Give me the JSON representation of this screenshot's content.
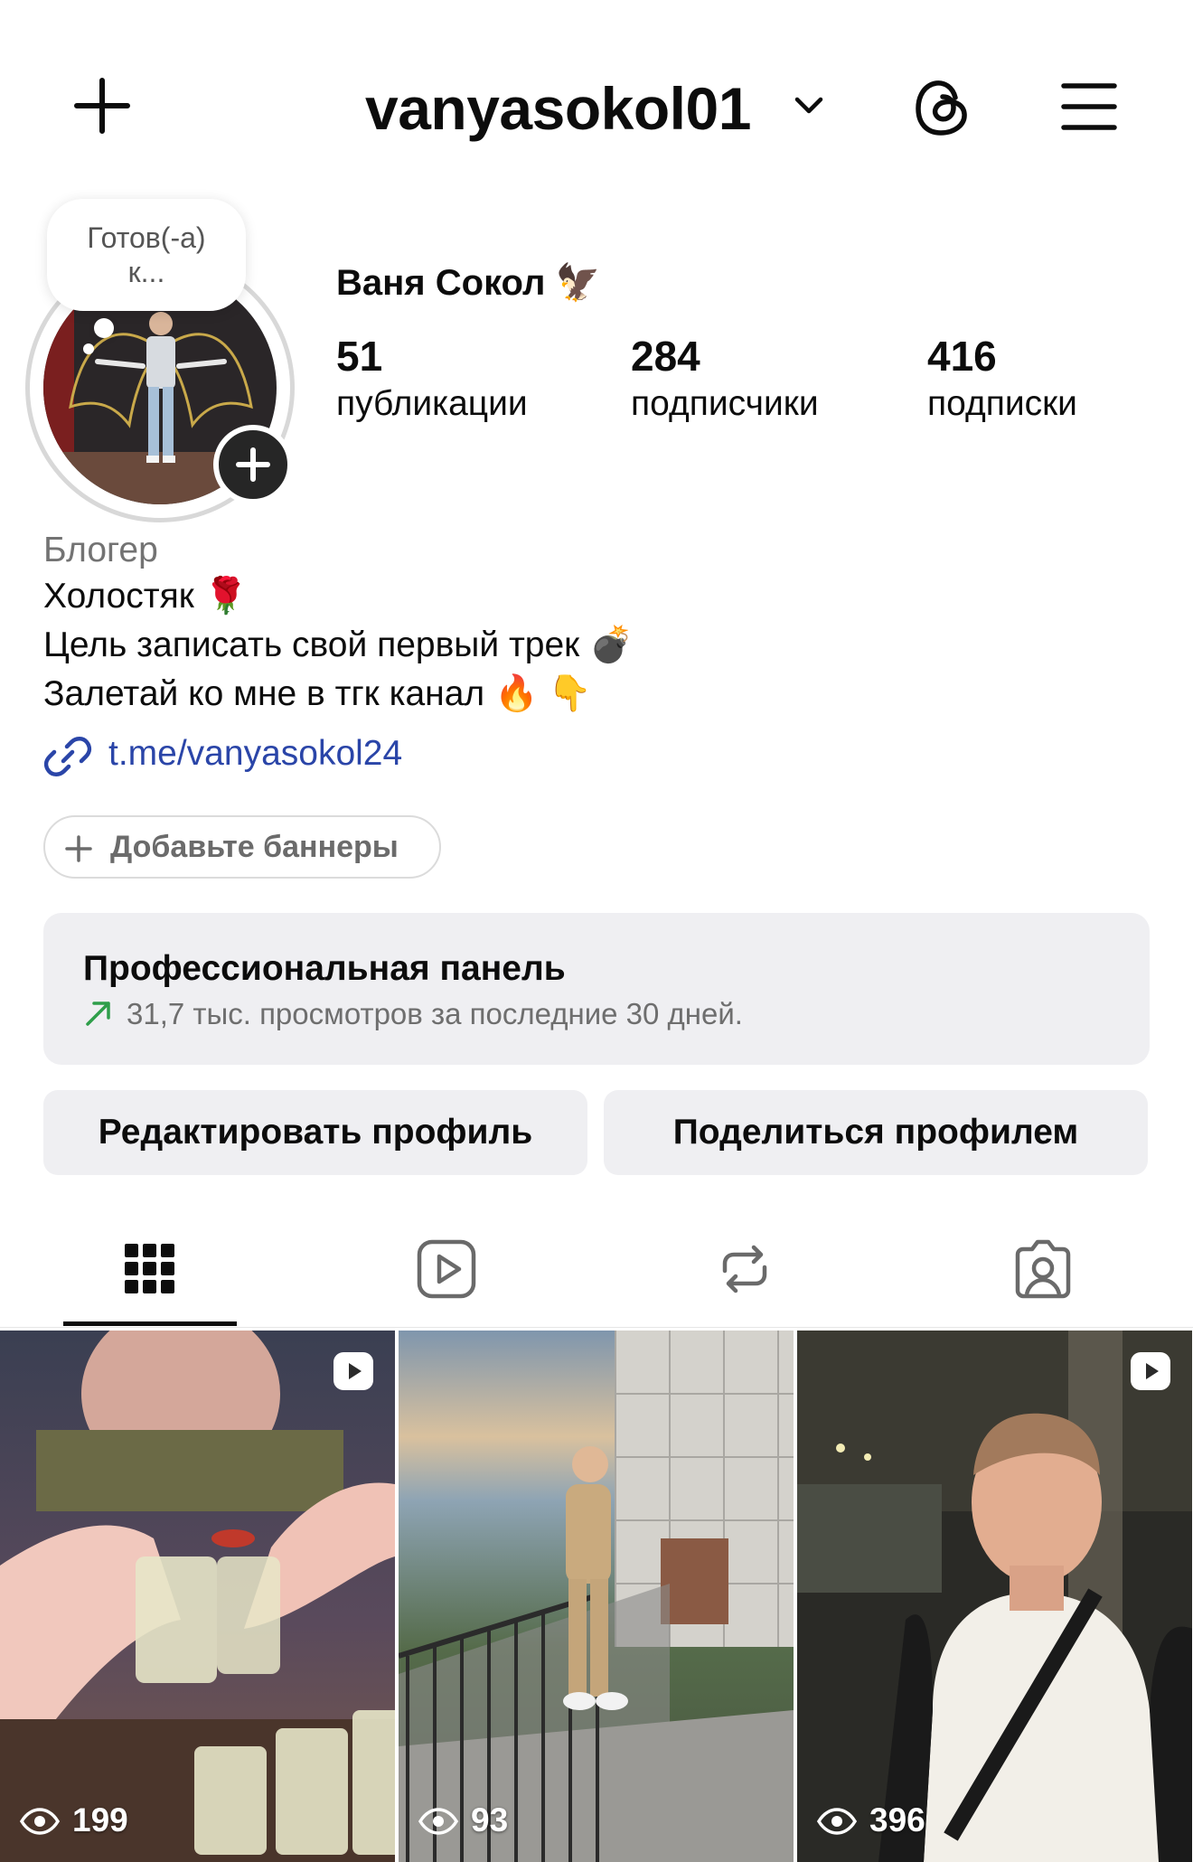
{
  "header": {
    "username": "vanyasokol01"
  },
  "profile": {
    "note": "Готов(-а)\nк...",
    "full_name": "Ваня Сокол 🦅",
    "stats": [
      {
        "value": "51",
        "label": "публикации"
      },
      {
        "value": "284",
        "label": "подписчики"
      },
      {
        "value": "416",
        "label": "подписки"
      }
    ]
  },
  "bio": {
    "category": "Блогер",
    "lines": [
      "Холостяк 🌹",
      "Цель записать свой первый трек 💣",
      "Залетай ко мне в тгк канал 🔥 👇"
    ],
    "link": "t.me/vanyasokol24"
  },
  "banner_button": "Добавьте баннеры",
  "pro_panel": {
    "title": "Профессиональная панель",
    "subtitle": "31,7 тыс. просмотров за последние 30 дней."
  },
  "actions": {
    "edit": "Редактировать профиль",
    "share": "Поделиться профилем"
  },
  "tabs": [
    "grid-icon",
    "reels-icon",
    "reposts-icon",
    "tagged-icon"
  ],
  "posts": [
    {
      "views": "199",
      "is_reel": true
    },
    {
      "views": "93",
      "is_reel": false
    },
    {
      "views": "396",
      "is_reel": true
    }
  ],
  "colors": {
    "link": "#2a45a8",
    "panel_bg": "#efeff2",
    "trend_arrow": "#2e9e4a"
  }
}
